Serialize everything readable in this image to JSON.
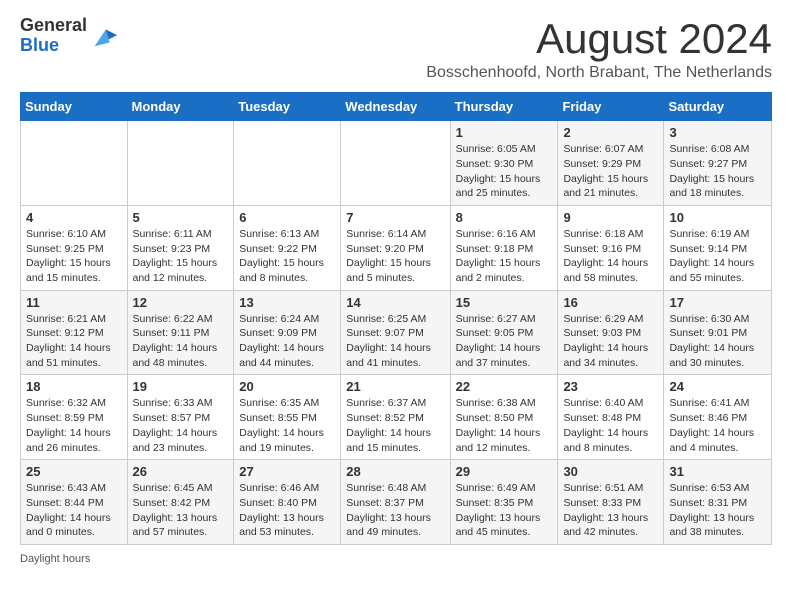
{
  "header": {
    "logo_general": "General",
    "logo_blue": "Blue",
    "month_title": "August 2024",
    "subtitle": "Bosschenhoofd, North Brabant, The Netherlands"
  },
  "calendar": {
    "days_of_week": [
      "Sunday",
      "Monday",
      "Tuesday",
      "Wednesday",
      "Thursday",
      "Friday",
      "Saturday"
    ],
    "weeks": [
      [
        {
          "day": "",
          "info": ""
        },
        {
          "day": "",
          "info": ""
        },
        {
          "day": "",
          "info": ""
        },
        {
          "day": "",
          "info": ""
        },
        {
          "day": "1",
          "info": "Sunrise: 6:05 AM\nSunset: 9:30 PM\nDaylight: 15 hours and 25 minutes."
        },
        {
          "day": "2",
          "info": "Sunrise: 6:07 AM\nSunset: 9:29 PM\nDaylight: 15 hours and 21 minutes."
        },
        {
          "day": "3",
          "info": "Sunrise: 6:08 AM\nSunset: 9:27 PM\nDaylight: 15 hours and 18 minutes."
        }
      ],
      [
        {
          "day": "4",
          "info": "Sunrise: 6:10 AM\nSunset: 9:25 PM\nDaylight: 15 hours and 15 minutes."
        },
        {
          "day": "5",
          "info": "Sunrise: 6:11 AM\nSunset: 9:23 PM\nDaylight: 15 hours and 12 minutes."
        },
        {
          "day": "6",
          "info": "Sunrise: 6:13 AM\nSunset: 9:22 PM\nDaylight: 15 hours and 8 minutes."
        },
        {
          "day": "7",
          "info": "Sunrise: 6:14 AM\nSunset: 9:20 PM\nDaylight: 15 hours and 5 minutes."
        },
        {
          "day": "8",
          "info": "Sunrise: 6:16 AM\nSunset: 9:18 PM\nDaylight: 15 hours and 2 minutes."
        },
        {
          "day": "9",
          "info": "Sunrise: 6:18 AM\nSunset: 9:16 PM\nDaylight: 14 hours and 58 minutes."
        },
        {
          "day": "10",
          "info": "Sunrise: 6:19 AM\nSunset: 9:14 PM\nDaylight: 14 hours and 55 minutes."
        }
      ],
      [
        {
          "day": "11",
          "info": "Sunrise: 6:21 AM\nSunset: 9:12 PM\nDaylight: 14 hours and 51 minutes."
        },
        {
          "day": "12",
          "info": "Sunrise: 6:22 AM\nSunset: 9:11 PM\nDaylight: 14 hours and 48 minutes."
        },
        {
          "day": "13",
          "info": "Sunrise: 6:24 AM\nSunset: 9:09 PM\nDaylight: 14 hours and 44 minutes."
        },
        {
          "day": "14",
          "info": "Sunrise: 6:25 AM\nSunset: 9:07 PM\nDaylight: 14 hours and 41 minutes."
        },
        {
          "day": "15",
          "info": "Sunrise: 6:27 AM\nSunset: 9:05 PM\nDaylight: 14 hours and 37 minutes."
        },
        {
          "day": "16",
          "info": "Sunrise: 6:29 AM\nSunset: 9:03 PM\nDaylight: 14 hours and 34 minutes."
        },
        {
          "day": "17",
          "info": "Sunrise: 6:30 AM\nSunset: 9:01 PM\nDaylight: 14 hours and 30 minutes."
        }
      ],
      [
        {
          "day": "18",
          "info": "Sunrise: 6:32 AM\nSunset: 8:59 PM\nDaylight: 14 hours and 26 minutes."
        },
        {
          "day": "19",
          "info": "Sunrise: 6:33 AM\nSunset: 8:57 PM\nDaylight: 14 hours and 23 minutes."
        },
        {
          "day": "20",
          "info": "Sunrise: 6:35 AM\nSunset: 8:55 PM\nDaylight: 14 hours and 19 minutes."
        },
        {
          "day": "21",
          "info": "Sunrise: 6:37 AM\nSunset: 8:52 PM\nDaylight: 14 hours and 15 minutes."
        },
        {
          "day": "22",
          "info": "Sunrise: 6:38 AM\nSunset: 8:50 PM\nDaylight: 14 hours and 12 minutes."
        },
        {
          "day": "23",
          "info": "Sunrise: 6:40 AM\nSunset: 8:48 PM\nDaylight: 14 hours and 8 minutes."
        },
        {
          "day": "24",
          "info": "Sunrise: 6:41 AM\nSunset: 8:46 PM\nDaylight: 14 hours and 4 minutes."
        }
      ],
      [
        {
          "day": "25",
          "info": "Sunrise: 6:43 AM\nSunset: 8:44 PM\nDaylight: 14 hours and 0 minutes."
        },
        {
          "day": "26",
          "info": "Sunrise: 6:45 AM\nSunset: 8:42 PM\nDaylight: 13 hours and 57 minutes."
        },
        {
          "day": "27",
          "info": "Sunrise: 6:46 AM\nSunset: 8:40 PM\nDaylight: 13 hours and 53 minutes."
        },
        {
          "day": "28",
          "info": "Sunrise: 6:48 AM\nSunset: 8:37 PM\nDaylight: 13 hours and 49 minutes."
        },
        {
          "day": "29",
          "info": "Sunrise: 6:49 AM\nSunset: 8:35 PM\nDaylight: 13 hours and 45 minutes."
        },
        {
          "day": "30",
          "info": "Sunrise: 6:51 AM\nSunset: 8:33 PM\nDaylight: 13 hours and 42 minutes."
        },
        {
          "day": "31",
          "info": "Sunrise: 6:53 AM\nSunset: 8:31 PM\nDaylight: 13 hours and 38 minutes."
        }
      ]
    ]
  },
  "footer": {
    "note": "Daylight hours"
  },
  "colors": {
    "header_bg": "#1a6fc4",
    "header_text": "#ffffff",
    "odd_row_bg": "#f5f5f5",
    "even_row_bg": "#ffffff"
  }
}
